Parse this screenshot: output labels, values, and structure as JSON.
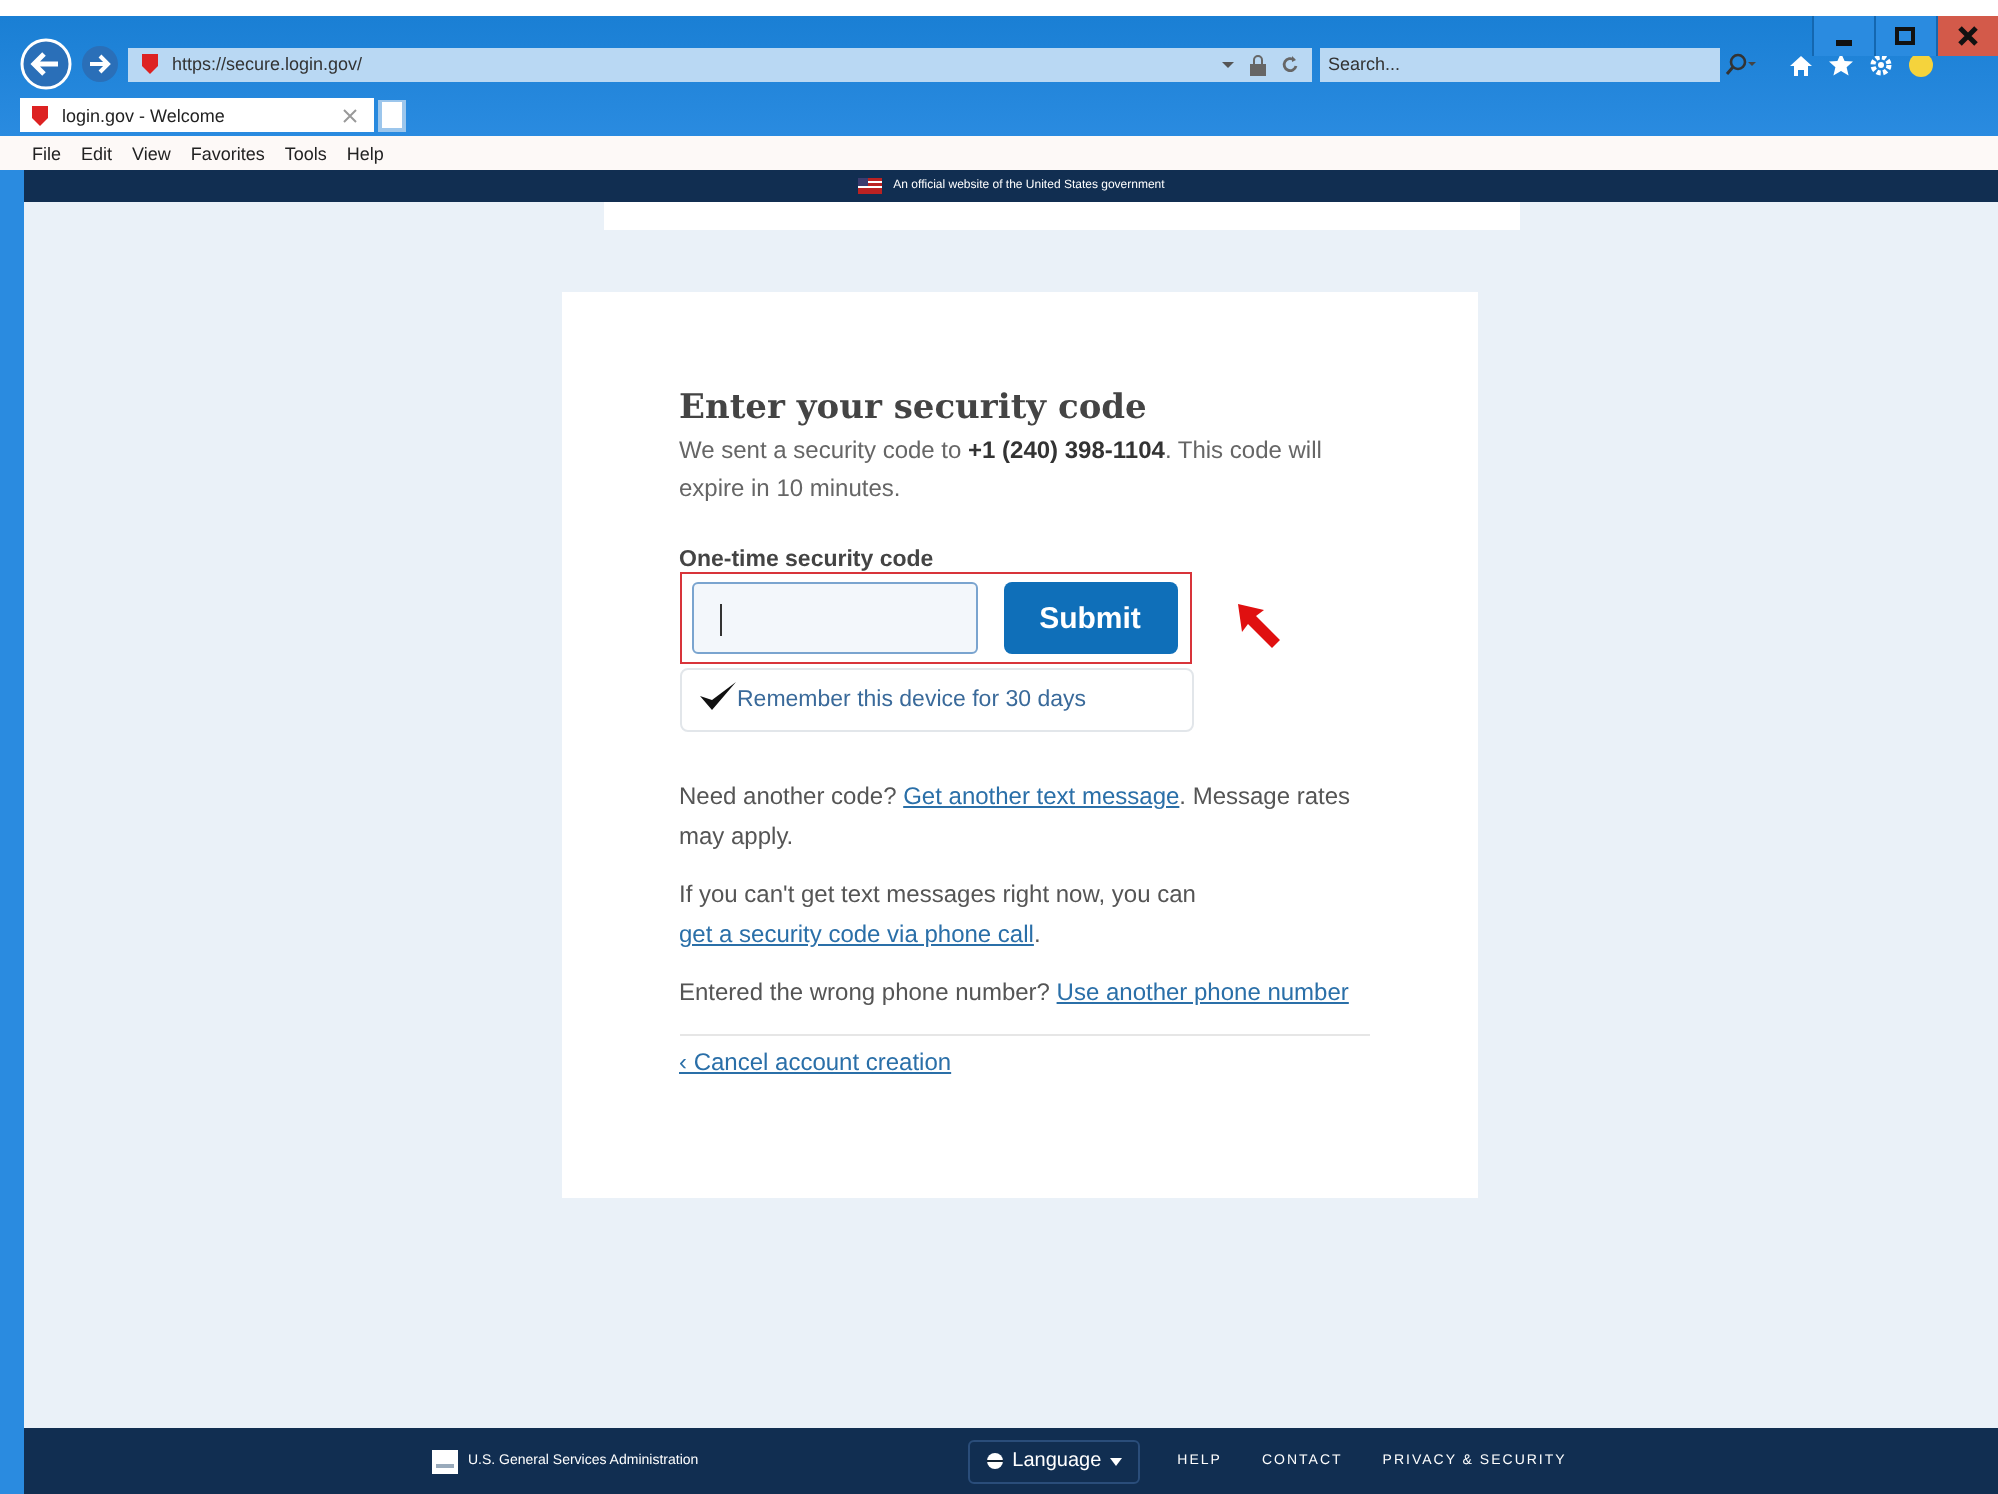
{
  "browser": {
    "address": "https://secure.login.gov/",
    "search": {
      "placeholder": "Search..."
    },
    "tabs": [
      {
        "title": "login.gov - Welcome",
        "selected": true
      }
    ],
    "menu": [
      "File",
      "Edit",
      "View",
      "Favorites",
      "Tools",
      "Help"
    ]
  },
  "banner": {
    "text": "An official website of the United States government"
  },
  "card": {
    "heading": "Enter your security code",
    "intro": "We sent a security code to **+1 (240) 398-1104**. This code will expire in 10 minutes.",
    "field": {
      "label": "One-time security code"
    },
    "submit": "Submit",
    "remember": {
      "label": "Remember this device for 30 days",
      "checked": true
    },
    "paragraphs": [
      {
        "before": "Need another code? ",
        "link": "Get another text message",
        "after": ". Message rates may apply."
      },
      {
        "before": "If you can't get text messages right now, you can ",
        "link": "get a security code via phone call",
        "after": "."
      },
      {
        "before": "Entered the wrong phone number? ",
        "link": "Use another phone number"
      }
    ],
    "cancel": "‹ Cancel account creation"
  },
  "footer": {
    "agency": "U.S. General Services Administration",
    "language": "Language",
    "links": [
      "HELP",
      "CONTACT",
      "PRIVACY & SECURITY"
    ]
  }
}
